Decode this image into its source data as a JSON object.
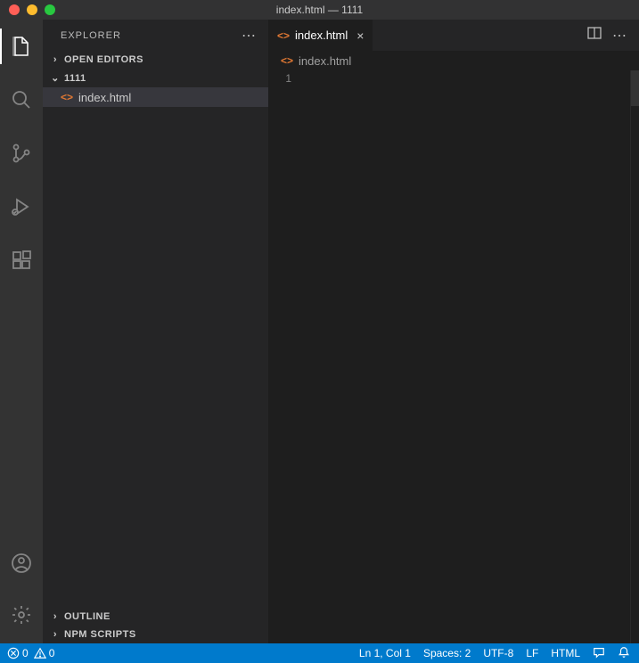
{
  "titlebar": {
    "title": "index.html — 1111"
  },
  "sidebar": {
    "title": "EXPLORER",
    "openEditorsLabel": "OPEN EDITORS",
    "folderName": "1111",
    "files": [
      {
        "name": "index.html"
      }
    ],
    "outlineLabel": "OUTLINE",
    "npmLabel": "NPM SCRIPTS"
  },
  "editor": {
    "tab": {
      "name": "index.html"
    },
    "breadcrumb": "index.html",
    "lineNumber": "1"
  },
  "statusbar": {
    "errors": "0",
    "warnings": "0",
    "lncol": "Ln 1, Col 1",
    "spaces": "Spaces: 2",
    "encoding": "UTF-8",
    "eol": "LF",
    "lang": "HTML"
  }
}
